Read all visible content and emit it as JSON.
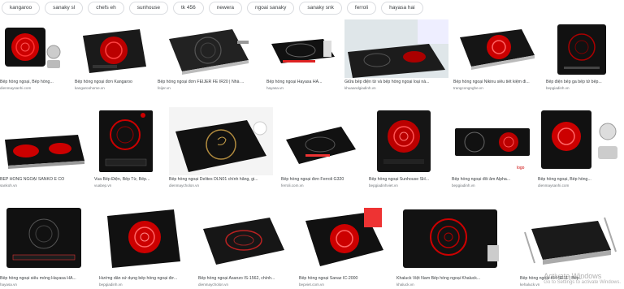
{
  "chips": [
    "kangaroo",
    "sanaky sl",
    "chefs eh",
    "sunhouse",
    "tk 456",
    "newera",
    "ngoai sanaky",
    "sanaky snk",
    "ferroli",
    "hayasa hai"
  ],
  "results": [
    {
      "title": "Bếp hồng ngoại, Bếp hồng...",
      "source": "dienmaysanhi.com"
    },
    {
      "title": "Bếp hồng ngoại đơn Kangaroo",
      "source": "kangaroohome.vn"
    },
    {
      "title": "Bếp hồng ngoại đơn FEIJER FE IR20 | Nhà ...",
      "source": "feijer.vn"
    },
    {
      "title": "Bếp hồng ngoại Hayasa HA...",
      "source": "hayasa.vn"
    },
    {
      "title": "Giữa bếp điện từ và bếp hồng ngoại loại nà...",
      "source": "khuaandgiadinh.vn"
    },
    {
      "title": "Bếp hồng ngoại Nikinu siêu tiết kiệm đi...",
      "source": "trangcongnghe.vn"
    },
    {
      "title": "Bếp điện bếp ga bếp tử bếp...",
      "source": "bepgiadinh.vn"
    },
    {
      "title": "BẾP HỒNG NGOẠI SANKO E CO",
      "source": "sankoh.vn"
    },
    {
      "title": "Vua Bếp Điện, Bếp Từ, Bếp...",
      "source": "vuabep.vn"
    },
    {
      "title": "Bếp hồng ngoại Delites DLN01 chính hãng, gi...",
      "source": "dienmaycholon.vn"
    },
    {
      "title": "Bếp hồng ngoại đơn Ferroli G320",
      "source": "ferroli.com.vn"
    },
    {
      "title": "Bếp hồng ngoại Sunhouse SH...",
      "source": "bepgiadinhviet.vn"
    },
    {
      "title": "Bếp hồng ngoại đôi âm Alpha...",
      "source": "bepgiadinh.vn"
    },
    {
      "title": "Bếp hồng ngoại, Bếp hồng...",
      "source": "dienmaysanhi.com"
    },
    {
      "title": "Bếp hồng ngoại siêu mỏng Hayasa HA...",
      "source": "hayasa.vn"
    },
    {
      "title": "Hướng dẫn sử dụng bếp hồng ngoại đơ...",
      "source": "bepgiadinh.vn"
    },
    {
      "title": "Bếp hồng ngoại Asanzo IS-1562, chính...",
      "source": "dienmaycholon.vn"
    },
    {
      "title": "Bếp hồng ngoại Sanaz IC-2000",
      "source": "bepviet.com.vn"
    },
    {
      "title": "Khaluck Việt Nam Bếp hồng ngoại Khaluck...",
      "source": "khaluck.vn"
    },
    {
      "title": "Bếp hồng ngoại KH-SE11 | Bếp...",
      "source": "kehaluck.vn"
    }
  ],
  "watermark": {
    "line1": "Activate Windows",
    "line2": "Go to Settings to activate Windows."
  }
}
